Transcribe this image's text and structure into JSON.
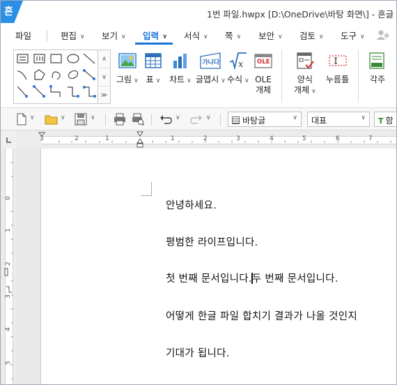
{
  "window": {
    "title": "1번 파일.hwpx [D:\\OneDrive\\바탕 화면\\] - 흔글",
    "app_logo": "흔"
  },
  "menu": {
    "items": [
      {
        "label": "파일",
        "has_chevron": false
      },
      {
        "label": "편집",
        "has_chevron": true
      },
      {
        "label": "보기",
        "has_chevron": true
      },
      {
        "label": "입력",
        "has_chevron": true,
        "active": true
      },
      {
        "label": "서식",
        "has_chevron": true
      },
      {
        "label": "쪽",
        "has_chevron": true
      },
      {
        "label": "보안",
        "has_chevron": true
      },
      {
        "label": "검토",
        "has_chevron": true
      },
      {
        "label": "도구",
        "has_chevron": true
      }
    ],
    "accent": "#1a73d9"
  },
  "ribbon": {
    "buttons": [
      {
        "label": "그림",
        "icon": "picture-icon",
        "chevron": true
      },
      {
        "label": "표",
        "icon": "table-icon",
        "chevron": true
      },
      {
        "label": "차트",
        "icon": "chart-icon",
        "chevron": true
      },
      {
        "label": "글맵시",
        "icon": "wordart-icon",
        "chevron": true
      },
      {
        "label": "수식",
        "icon": "formula-icon",
        "chevron": true
      },
      {
        "label": "OLE",
        "label2": "개체",
        "icon": "ole-icon",
        "chevron": false
      },
      {
        "label": "양식",
        "label2": "개체",
        "icon": "form-object-icon",
        "chevron": true
      },
      {
        "label": "누름틀",
        "icon": "field-icon",
        "chevron": false
      },
      {
        "label": "각주",
        "icon": "footnote-icon",
        "chevron": false
      }
    ],
    "wordart_text": "가나다",
    "ole_text": "OLE"
  },
  "toolbar": {
    "style_combo": "바탕글",
    "font_combo": "대표",
    "font_partial": "함"
  },
  "ruler": {
    "h_numbers": [
      "3",
      "2",
      "1",
      "1",
      "2",
      "3",
      "4",
      "5",
      "6",
      "7",
      "8",
      "9"
    ],
    "v_numbers": [
      "0",
      "1",
      "2",
      "3",
      "4",
      "5"
    ]
  },
  "document": {
    "paragraphs": [
      "안녕하세요.",
      "평범한 라이프입니다.",
      "첫 번째 문서입니다.",
      "두 번째 문서입니다.",
      "어떻게 한글 파일 합치기 결과가 나올 것인지",
      "기대가 됩니다."
    ]
  }
}
